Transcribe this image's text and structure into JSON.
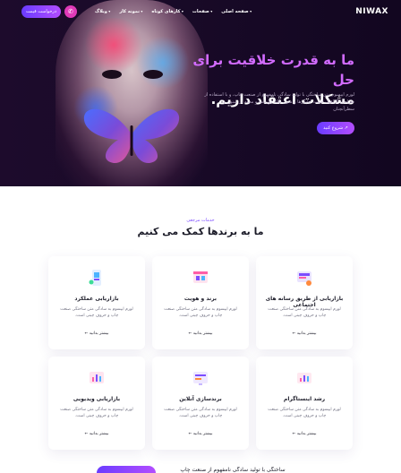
{
  "header": {
    "logo": "NIWAX",
    "menu": [
      "صفحه اصلی",
      "صفحات",
      "کارهای کوتاه",
      "نمونه کار",
      "وبلاگ"
    ],
    "cta": "درخواست قیمت",
    "phone_icon": "phone-icon"
  },
  "hero": {
    "title_line1": "ما به قدرت خلاقیت برای حل",
    "title_line2": "مشکلات اعتقاد داریم.",
    "description": "لورم ایپسوم متن ساختگی با تولید سادگی نامفهوم از صنعت چاپ، و با استفاده از طراحان گرافیک است، چاپگرها و متون بلکه روزنامه و مجله در ستون و سطرآنچنان",
    "button": "شروع کنید ↗"
  },
  "services": {
    "kicker": "خدمات مرجعی",
    "title": "ما به برندها کمک می کنیم",
    "cards": [
      {
        "title": "بازاریابی از طریق رسانه های اجتماعی",
        "desc": "لورم ایپسوم به سادگی متن ساختگی صنعت چاپ و حروف چینی است.",
        "more": "بیشتر بدانید",
        "icon": "social-media-icon"
      },
      {
        "title": "برند و هویت",
        "desc": "لورم ایپسوم به سادگی متن ساختگی صنعت چاپ و حروف چینی است.",
        "more": "بیشتر بدانید",
        "icon": "branding-icon"
      },
      {
        "title": "بازاریابی عملکرد",
        "desc": "لورم ایپسوم به سادگی متن ساختگی صنعت چاپ و حروف چینی است.",
        "more": "بیشتر بدانید",
        "icon": "performance-icon"
      },
      {
        "title": "رشد اینستاگرام",
        "desc": "لورم ایپسوم به سادگی متن ساختگی صنعت چاپ و حروف چینی است.",
        "more": "بیشتر بدانید",
        "icon": "instagram-growth-icon"
      },
      {
        "title": "برندسازی آنلاین",
        "desc": "لورم ایپسوم به سادگی متن ساختگی صنعت چاپ و حروف چینی است.",
        "more": "بیشتر بدانید",
        "icon": "online-branding-icon"
      },
      {
        "title": "بازاریابی ویدیویی",
        "desc": "لورم ایپسوم به سادگی متن ساختگی صنعت چاپ و حروف چینی است.",
        "more": "بیشتر بدانید",
        "icon": "video-marketing-icon"
      }
    ]
  },
  "footer_teaser": "ساختگی با تولید سادگی نامفهوم از صنعت چاپ"
}
